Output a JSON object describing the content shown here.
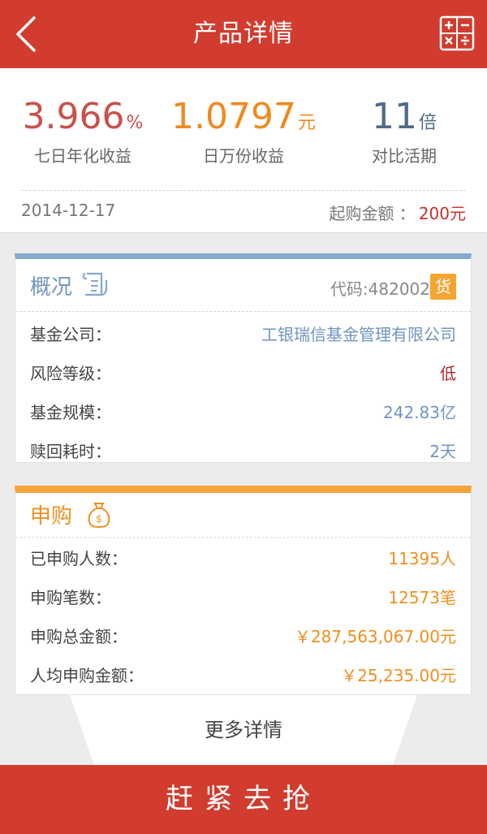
{
  "header": {
    "title": "产品详情",
    "back_icon": "chevron-left-icon",
    "calc_icon": "calculator-icon"
  },
  "summary": {
    "yield_7d": {
      "value": "3.966",
      "unit": "%",
      "label": "七日年化收益"
    },
    "per_10k": {
      "value": "1.0797",
      "unit": "元",
      "label": "日万份收益"
    },
    "vs_current": {
      "value": "11",
      "unit": "倍",
      "label": "对比活期"
    },
    "date": "2014-12-17",
    "min_buy_label": "起购金额 ：",
    "min_buy_value": "200元"
  },
  "overview": {
    "title": "概况",
    "code": "代码:482002",
    "badge": "货",
    "rows": [
      {
        "label": "基金公司：",
        "value": "工银瑞信基金管理有限公司"
      },
      {
        "label": "风险等级：",
        "value": "低"
      },
      {
        "label": "基金规模：",
        "value": "242.83亿"
      },
      {
        "label": "赎回耗时：",
        "value": "2天"
      }
    ]
  },
  "purchase": {
    "title": "申购",
    "rows": [
      {
        "label": "已申购人数：",
        "value": "11395人"
      },
      {
        "label": "申购笔数：",
        "value": "12573笔"
      },
      {
        "label": "申购总金额：",
        "value": "￥287,563,067.00元"
      },
      {
        "label": "人均申购金额：",
        "value": "￥25,235.00元"
      }
    ]
  },
  "more_label": "更多详情",
  "buy_label": "赶紧去抢",
  "colors": {
    "primary": "#d13c2e",
    "orange": "#f0891d",
    "blue": "#6f95c0",
    "red": "#c9302c"
  }
}
